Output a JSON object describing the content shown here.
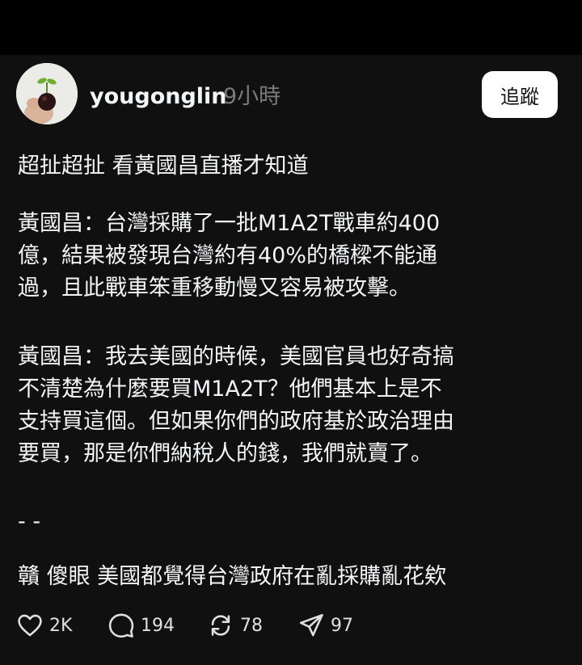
{
  "post": {
    "username": "yougonglin",
    "timestamp": "9小時",
    "follow_label": "追蹤",
    "paragraphs": {
      "p1": {
        "line1": "超扯超扯 看黃國昌直播才知道"
      },
      "p2": {
        "line1": "黃國昌：台灣採購了一批M1A2T戰車約400",
        "line2": "億，結果被發現台灣約有40%的橋樑不能通",
        "line3": "過，且此戰車笨重移動慢又容易被攻擊。"
      },
      "p3": {
        "line1": "黃國昌：我去美國的時候，美國官員也好奇搞",
        "line2": "不清楚為什麼要買M1A2T？他們基本上是不",
        "line3": "支持買這個。但如果你們的政府基於政治理由",
        "line4": "要買，那是你們納稅人的錢，我們就賣了。"
      },
      "p4": {
        "line1": "- -"
      },
      "p5": {
        "line1": "贛 傻眼 美國都覺得台灣政府在亂採購亂花欸"
      }
    },
    "actions": {
      "likes": "2K",
      "replies": "194",
      "reposts": "78",
      "shares": "97"
    }
  },
  "icons": {
    "avatar": "avatar-photo",
    "like": "heart-icon",
    "reply": "speech-bubble-icon",
    "repost": "repost-icon",
    "share": "paper-plane-icon"
  },
  "colors": {
    "background": "#101010",
    "text": "#f3f5f7",
    "muted": "#7a7a7a",
    "button_bg": "#ffffff"
  }
}
